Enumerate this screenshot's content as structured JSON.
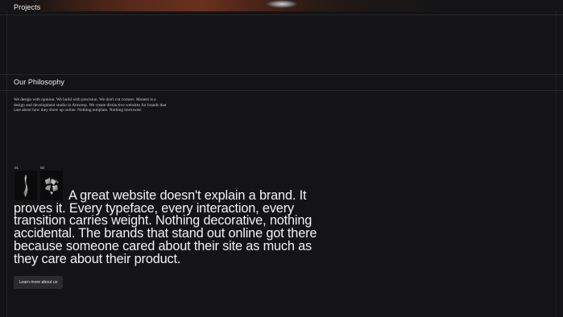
{
  "projects": {
    "title": "Projects"
  },
  "philosophy": {
    "title": "Our Philosophy",
    "intro": "We design with opinion. We build with precision. We don't cut corners. Monest is a design and development studio in Antwerp. We create distinctive websites for brands that care about how they show up online. Nothing template. Nothing borrowed.",
    "thumbnails": [
      {
        "number": "01",
        "icon": "twisted-chrome-shape-icon"
      },
      {
        "number": "02",
        "icon": "chrome-shards-icon"
      }
    ],
    "statement": "A great website doesn't explain a brand. It proves it. Every typeface, every interaction, every transition carries weight. Nothing decorative, nothing accidental. The brands that stand out online got there because someone cared about their site as much as they care about their product.",
    "cta_label": "Learn more about us"
  },
  "colors": {
    "background": "#141416",
    "text": "#f2f2f2",
    "button": "#2b2b2f"
  }
}
